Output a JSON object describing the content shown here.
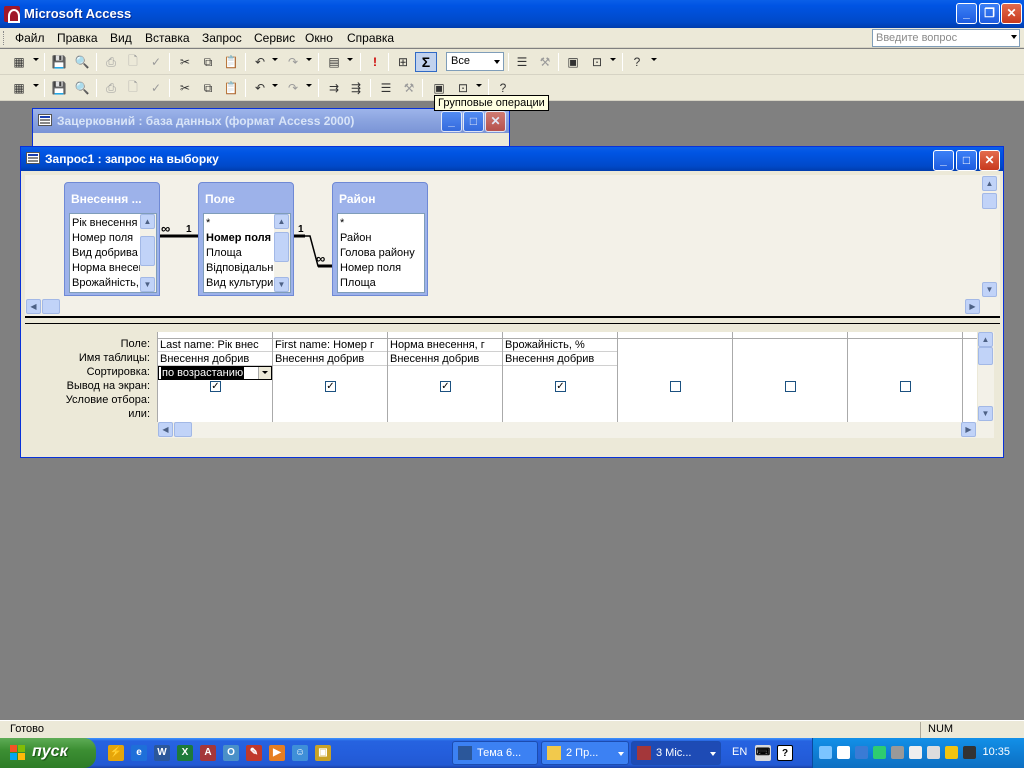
{
  "app": {
    "title": "Microsoft Access"
  },
  "menu": {
    "items": [
      "Файл",
      "Правка",
      "Вид",
      "Вставка",
      "Запрос",
      "Сервис",
      "Окно",
      "Справка"
    ],
    "ask_placeholder": "Введите вопрос"
  },
  "toolbar": {
    "topvalues": "Все",
    "tooltip": "Групповые операции"
  },
  "db_window": {
    "title": "Зацерковний : база данных (формат Access 2000)"
  },
  "query_window": {
    "title": "Запрос1 : запрос на выборку"
  },
  "tables": [
    {
      "title": "Внесення ...",
      "fields": [
        "Рік внесення",
        "Номер поля",
        "Вид добрива",
        "Норма внесен",
        "Врожайність,"
      ]
    },
    {
      "title": "Поле",
      "fields": [
        "*",
        "Номер поля",
        "Площа",
        "Відповідальн",
        "Вид культури"
      ]
    },
    {
      "title": "Район",
      "fields": [
        "*",
        "Район",
        "Голова району",
        "Номер поля",
        "Площа"
      ]
    }
  ],
  "relations": {
    "many": "∞",
    "one": "1"
  },
  "grid": {
    "row_labels": [
      "Поле:",
      "Имя таблицы:",
      "Сортировка:",
      "Вывод на экран:",
      "Условие отбора:",
      "или:"
    ],
    "columns": [
      {
        "field": "Last name: Рік внес",
        "table": "Внесення добрив",
        "sort": "по возрастанию",
        "show": true
      },
      {
        "field": "First name: Номер г",
        "table": "Внесення добрив",
        "sort": "",
        "show": true
      },
      {
        "field": "Норма внесення, г",
        "table": "Внесення добрив",
        "sort": "",
        "show": true
      },
      {
        "field": "Врожайність, %",
        "table": "Внесення добрив",
        "sort": "",
        "show": true
      },
      {
        "field": "",
        "table": "",
        "sort": "",
        "show": false
      },
      {
        "field": "",
        "table": "",
        "sort": "",
        "show": false
      },
      {
        "field": "",
        "table": "",
        "sort": "",
        "show": false
      }
    ]
  },
  "status": {
    "text": "Готово",
    "num": "NUM"
  },
  "taskbar": {
    "start": "пуск",
    "tasks": [
      "Тема 6...",
      "2 Пр...",
      "3 Mic..."
    ],
    "lang": "EN",
    "clock": "10:35"
  }
}
